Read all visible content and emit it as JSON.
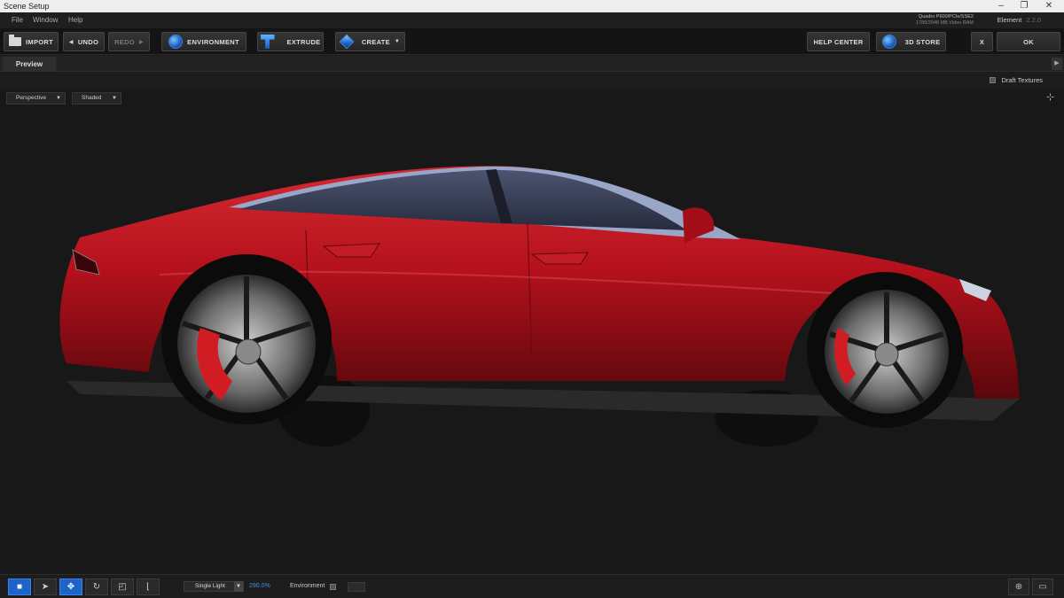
{
  "window": {
    "title": "Scene Setup",
    "controls": [
      "–",
      "❐",
      "✕"
    ]
  },
  "menu": [
    "File",
    "Window",
    "Help"
  ],
  "status": {
    "gpu_line1": "Quadro P600/PCIe/SSE2",
    "gpu_line2": "1789/2048 MB Video RAM",
    "app_name": "Element",
    "app_version": "2.2.0"
  },
  "toolbar": {
    "import": "IMPORT",
    "undo": "UNDO",
    "redo": "REDO",
    "environment": "ENVIRONMENT",
    "extrude": "EXTRUDE",
    "create": "CREATE",
    "help_center": "HELP CENTER",
    "store": "3D STORE",
    "close": "X",
    "ok": "OK"
  },
  "tabs": {
    "preview": "Preview"
  },
  "options": {
    "draft_textures": "Draft Textures"
  },
  "viewport": {
    "view_mode": "Perspective",
    "shading": "Shaded"
  },
  "bottom": {
    "light": "Single Light",
    "intensity": "290.0%",
    "environment": "Environment"
  },
  "colors": {
    "accent_blue": "#1d63c9",
    "car_red": "#b4111c",
    "percent_blue": "#3d8fe8"
  }
}
